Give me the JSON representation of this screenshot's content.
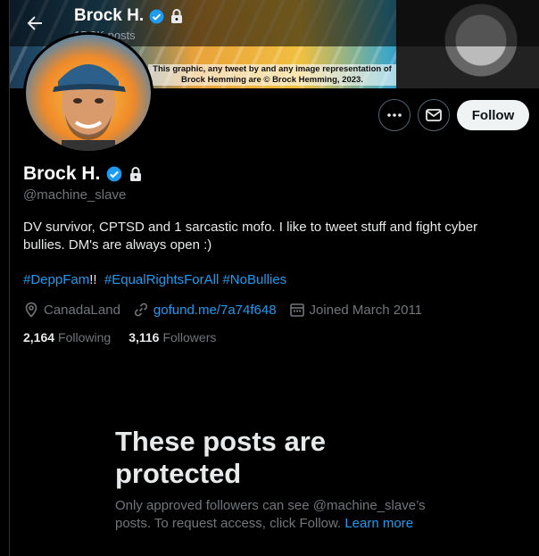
{
  "header": {
    "name": "Brock H.",
    "posts_count": "15.3K posts"
  },
  "banner": {
    "caption": "This graphic, any tweet by and any image representation of Brock Hemming are © Brock Hemming, 2023."
  },
  "actions": {
    "follow_label": "Follow"
  },
  "profile": {
    "name": "Brock H.",
    "handle": "@machine_slave",
    "bio": "DV survivor, CPTSD and 1 sarcastic mofo.  I like to tweet stuff and fight cyber bullies.  DM's are always open :)",
    "hashtags": [
      "#DeppFam",
      "#EqualRightsForAll",
      "#NoBullies"
    ],
    "hashtag_suffix": "!!",
    "location": "CanadaLand",
    "link": "gofund.me/7a74f648",
    "joined": "Joined March 2011",
    "following_count": "2,164",
    "following_label": "Following",
    "followers_count": "3,116",
    "followers_label": "Followers"
  },
  "protected": {
    "title": "These posts are protected",
    "text": "Only approved followers can see @machine_slave’s posts. To request access, click Follow.",
    "learn_more": "Learn more"
  },
  "colors": {
    "accent": "#1d9bf0",
    "background": "#000000",
    "muted": "#71767b",
    "follow_bg": "#eff3f4"
  },
  "icons": [
    "back-arrow-icon",
    "verified-badge-icon",
    "lock-icon",
    "more-icon",
    "message-icon",
    "location-icon",
    "link-icon",
    "calendar-icon"
  ]
}
